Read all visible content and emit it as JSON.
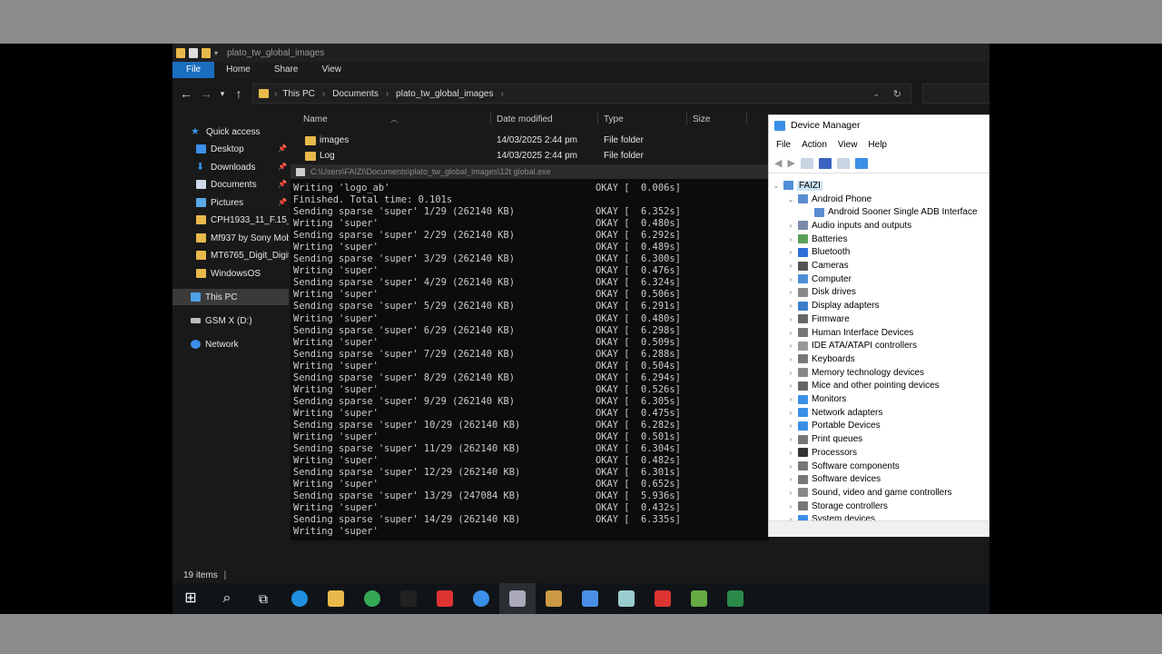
{
  "explorer": {
    "title": "plato_tw_global_images",
    "ribbon_tabs": [
      "File",
      "Home",
      "Share",
      "View"
    ],
    "breadcrumb": [
      "This PC",
      "Documents",
      "plato_tw_global_images"
    ],
    "nav": {
      "quick_access": "Quick access",
      "items": [
        "Desktop",
        "Downloads",
        "Documents",
        "Pictures",
        "CPH1933_11_F.15_2",
        "Mf937 by Sony Mob",
        "MT6765_Digit_Digiti",
        "WindowsOS"
      ],
      "this_pc": "This PC",
      "drive": "GSM X (D:)",
      "network": "Network"
    },
    "columns": [
      "Name",
      "Date modified",
      "Type",
      "Size"
    ],
    "files": [
      {
        "name": "images",
        "date": "14/03/2025 2:44 pm",
        "type": "File folder"
      },
      {
        "name": "Log",
        "date": "14/03/2025 2:44 pm",
        "type": "File folder"
      }
    ],
    "status": "19 items"
  },
  "console": {
    "title": "C:\\Users\\FAIZI\\Documents\\plato_tw_global_images\\12t global.exe",
    "lines": [
      {
        "l": "Writing 'logo_ab'",
        "r": "OKAY [  0.006s]"
      },
      {
        "l": "Finished. Total time: 0.101s",
        "r": ""
      },
      {
        "l": "Sending sparse 'super' 1/29 (262140 KB)",
        "r": "OKAY [  6.352s]"
      },
      {
        "l": "Writing 'super'",
        "r": "OKAY [  0.480s]"
      },
      {
        "l": "Sending sparse 'super' 2/29 (262140 KB)",
        "r": "OKAY [  6.292s]"
      },
      {
        "l": "Writing 'super'",
        "r": "OKAY [  0.489s]"
      },
      {
        "l": "Sending sparse 'super' 3/29 (262140 KB)",
        "r": "OKAY [  6.300s]"
      },
      {
        "l": "Writing 'super'",
        "r": "OKAY [  0.476s]"
      },
      {
        "l": "Sending sparse 'super' 4/29 (262140 KB)",
        "r": "OKAY [  6.324s]"
      },
      {
        "l": "Writing 'super'",
        "r": "OKAY [  0.506s]"
      },
      {
        "l": "Sending sparse 'super' 5/29 (262140 KB)",
        "r": "OKAY [  6.291s]"
      },
      {
        "l": "Writing 'super'",
        "r": "OKAY [  0.480s]"
      },
      {
        "l": "Sending sparse 'super' 6/29 (262140 KB)",
        "r": "OKAY [  6.298s]"
      },
      {
        "l": "Writing 'super'",
        "r": "OKAY [  0.509s]"
      },
      {
        "l": "Sending sparse 'super' 7/29 (262140 KB)",
        "r": "OKAY [  6.288s]"
      },
      {
        "l": "Writing 'super'",
        "r": "OKAY [  0.504s]"
      },
      {
        "l": "Sending sparse 'super' 8/29 (262140 KB)",
        "r": "OKAY [  6.294s]"
      },
      {
        "l": "Writing 'super'",
        "r": "OKAY [  0.526s]"
      },
      {
        "l": "Sending sparse 'super' 9/29 (262140 KB)",
        "r": "OKAY [  6.305s]"
      },
      {
        "l": "Writing 'super'",
        "r": "OKAY [  0.475s]"
      },
      {
        "l": "Sending sparse 'super' 10/29 (262140 KB)",
        "r": "OKAY [  6.282s]"
      },
      {
        "l": "Writing 'super'",
        "r": "OKAY [  0.501s]"
      },
      {
        "l": "Sending sparse 'super' 11/29 (262140 KB)",
        "r": "OKAY [  6.304s]"
      },
      {
        "l": "Writing 'super'",
        "r": "OKAY [  0.482s]"
      },
      {
        "l": "Sending sparse 'super' 12/29 (262140 KB)",
        "r": "OKAY [  6.301s]"
      },
      {
        "l": "Writing 'super'",
        "r": "OKAY [  0.652s]"
      },
      {
        "l": "Sending sparse 'super' 13/29 (247084 KB)",
        "r": "OKAY [  5.936s]"
      },
      {
        "l": "Writing 'super'",
        "r": "OKAY [  0.432s]"
      },
      {
        "l": "Sending sparse 'super' 14/29 (262140 KB)",
        "r": "OKAY [  6.335s]"
      },
      {
        "l": "Writing 'super'",
        "r": ""
      }
    ]
  },
  "device_manager": {
    "title": "Device Manager",
    "menu": [
      "File",
      "Action",
      "View",
      "Help"
    ],
    "root": "FAIZI",
    "android_phone": "Android Phone",
    "android_child": "Android Sooner Single ADB Interface",
    "categories": [
      "Audio inputs and outputs",
      "Batteries",
      "Bluetooth",
      "Cameras",
      "Computer",
      "Disk drives",
      "Display adapters",
      "Firmware",
      "Human Interface Devices",
      "IDE ATA/ATAPI controllers",
      "Keyboards",
      "Memory technology devices",
      "Mice and other pointing devices",
      "Monitors",
      "Network adapters",
      "Portable Devices",
      "Print queues",
      "Processors",
      "Software components",
      "Software devices",
      "Sound, video and game controllers",
      "Storage controllers",
      "System devices"
    ]
  },
  "taskbar_icons": [
    "windows-start-icon",
    "search-icon",
    "task-view-icon",
    "edge-icon",
    "file-explorer-icon",
    "chrome-icon",
    "terminal-icon",
    "app-red-icon",
    "app-blue-icon",
    "app-tool-icon",
    "app-multi-icon",
    "app-pen-icon",
    "app-gray-icon",
    "app-red2-icon",
    "app-green-icon",
    "app-excel-icon"
  ]
}
